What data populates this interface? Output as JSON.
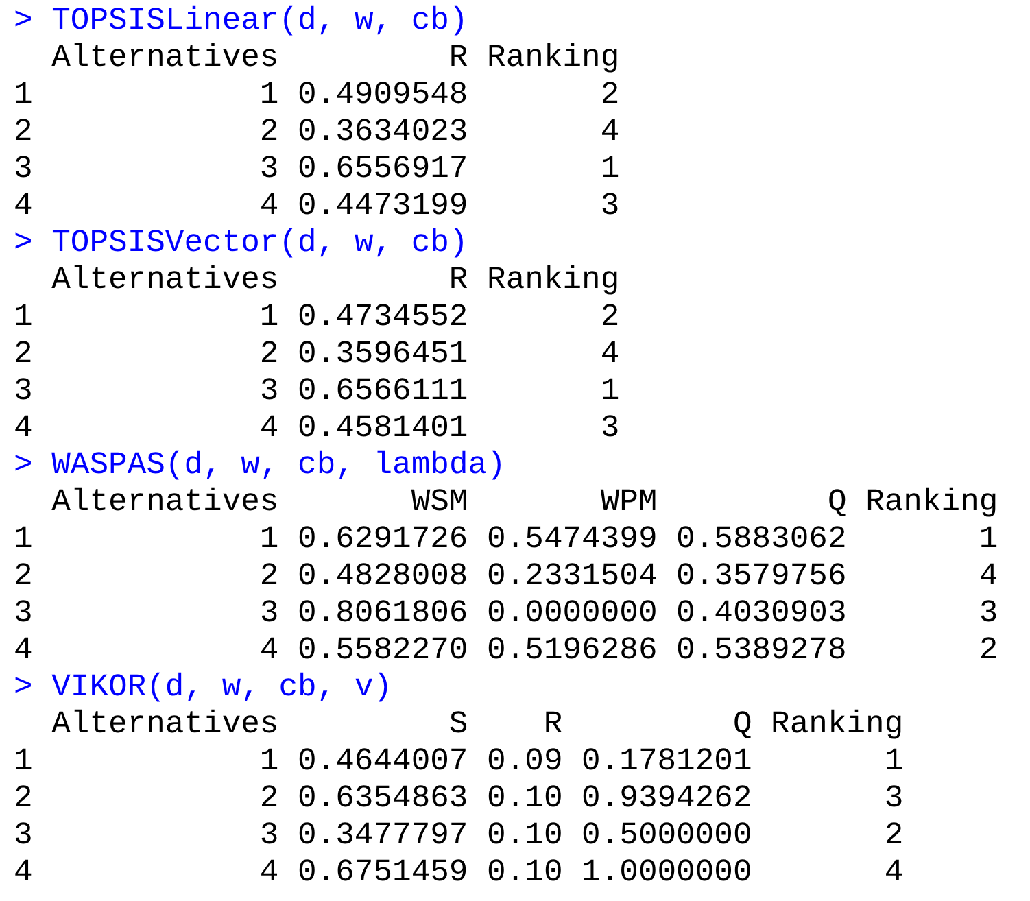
{
  "console": [
    {
      "prompt": ">",
      "command": "TOPSISLinear(d, w, cb)",
      "columns": [
        "Alternatives",
        "R",
        "Ranking"
      ],
      "rows": [
        {
          "name": "1",
          "cells": [
            "1",
            "0.4909548",
            "2"
          ]
        },
        {
          "name": "2",
          "cells": [
            "2",
            "0.3634023",
            "4"
          ]
        },
        {
          "name": "3",
          "cells": [
            "3",
            "0.6556917",
            "1"
          ]
        },
        {
          "name": "4",
          "cells": [
            "4",
            "0.4473199",
            "3"
          ]
        }
      ]
    },
    {
      "prompt": ">",
      "command": "TOPSISVector(d, w, cb)",
      "columns": [
        "Alternatives",
        "R",
        "Ranking"
      ],
      "rows": [
        {
          "name": "1",
          "cells": [
            "1",
            "0.4734552",
            "2"
          ]
        },
        {
          "name": "2",
          "cells": [
            "2",
            "0.3596451",
            "4"
          ]
        },
        {
          "name": "3",
          "cells": [
            "3",
            "0.6566111",
            "1"
          ]
        },
        {
          "name": "4",
          "cells": [
            "4",
            "0.4581401",
            "3"
          ]
        }
      ]
    },
    {
      "prompt": ">",
      "command": "WASPAS(d, w, cb, lambda)",
      "columns": [
        "Alternatives",
        "WSM",
        "WPM",
        "Q",
        "Ranking"
      ],
      "rows": [
        {
          "name": "1",
          "cells": [
            "1",
            "0.6291726",
            "0.5474399",
            "0.5883062",
            "1"
          ]
        },
        {
          "name": "2",
          "cells": [
            "2",
            "0.4828008",
            "0.2331504",
            "0.3579756",
            "4"
          ]
        },
        {
          "name": "3",
          "cells": [
            "3",
            "0.8061806",
            "0.0000000",
            "0.4030903",
            "3"
          ]
        },
        {
          "name": "4",
          "cells": [
            "4",
            "0.5582270",
            "0.5196286",
            "0.5389278",
            "2"
          ]
        }
      ]
    },
    {
      "prompt": ">",
      "command": "VIKOR(d, w, cb, v)",
      "columns": [
        "Alternatives",
        "S",
        "R",
        "Q",
        "Ranking"
      ],
      "rows": [
        {
          "name": "1",
          "cells": [
            "1",
            "0.4644007",
            "0.09",
            "0.1781201",
            "1"
          ]
        },
        {
          "name": "2",
          "cells": [
            "2",
            "0.6354863",
            "0.10",
            "0.9394262",
            "3"
          ]
        },
        {
          "name": "3",
          "cells": [
            "3",
            "0.3477797",
            "0.10",
            "0.5000000",
            "2"
          ]
        },
        {
          "name": "4",
          "cells": [
            "4",
            "0.6751459",
            "0.10",
            "1.0000000",
            "4"
          ]
        }
      ]
    }
  ]
}
